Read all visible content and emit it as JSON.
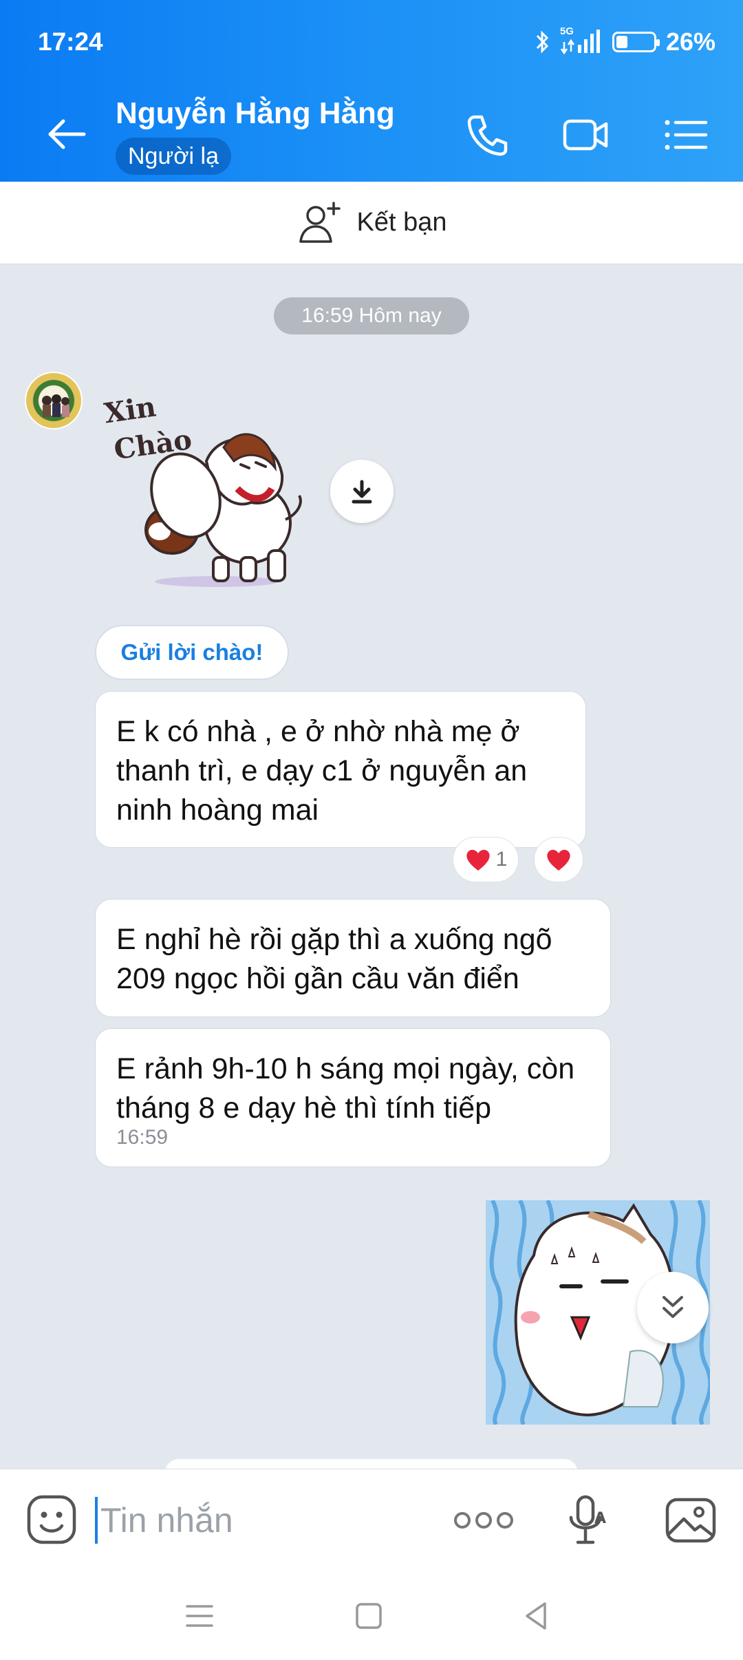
{
  "status_bar": {
    "time": "17:24",
    "network": "5G",
    "battery": "26%"
  },
  "header": {
    "contact_name": "Nguyễn Hằng Hằng",
    "badge": "Người lạ"
  },
  "add_friend": {
    "label": "Kết bạn"
  },
  "chat": {
    "time_chip": "16:59 Hôm nay",
    "sticker_text": "Xin Chào",
    "greet_button": "Gửi lời chào!",
    "messages": [
      {
        "text": "E k có nhà , e ở nhờ nhà mẹ ở thanh trì, e dạy c1 ở nguyễn an ninh hoàng mai"
      },
      {
        "text": "E nghỉ hè rồi gặp thì a xuống ngõ 209 ngọc hồi gần cầu văn điển"
      },
      {
        "text": "E rảnh 9h-10 h sáng mọi ngày, còn tháng 8 e dạy hè thì tính tiếp",
        "time": "16:59"
      }
    ],
    "reaction_count": "1"
  },
  "input": {
    "placeholder": "Tin nhắn"
  },
  "colors": {
    "header_start": "#0b7bf3",
    "header_end": "#2ea2f8",
    "chat_bg": "#e3e8ef",
    "accent": "#1a7fe0",
    "heart": "#e8243b"
  }
}
